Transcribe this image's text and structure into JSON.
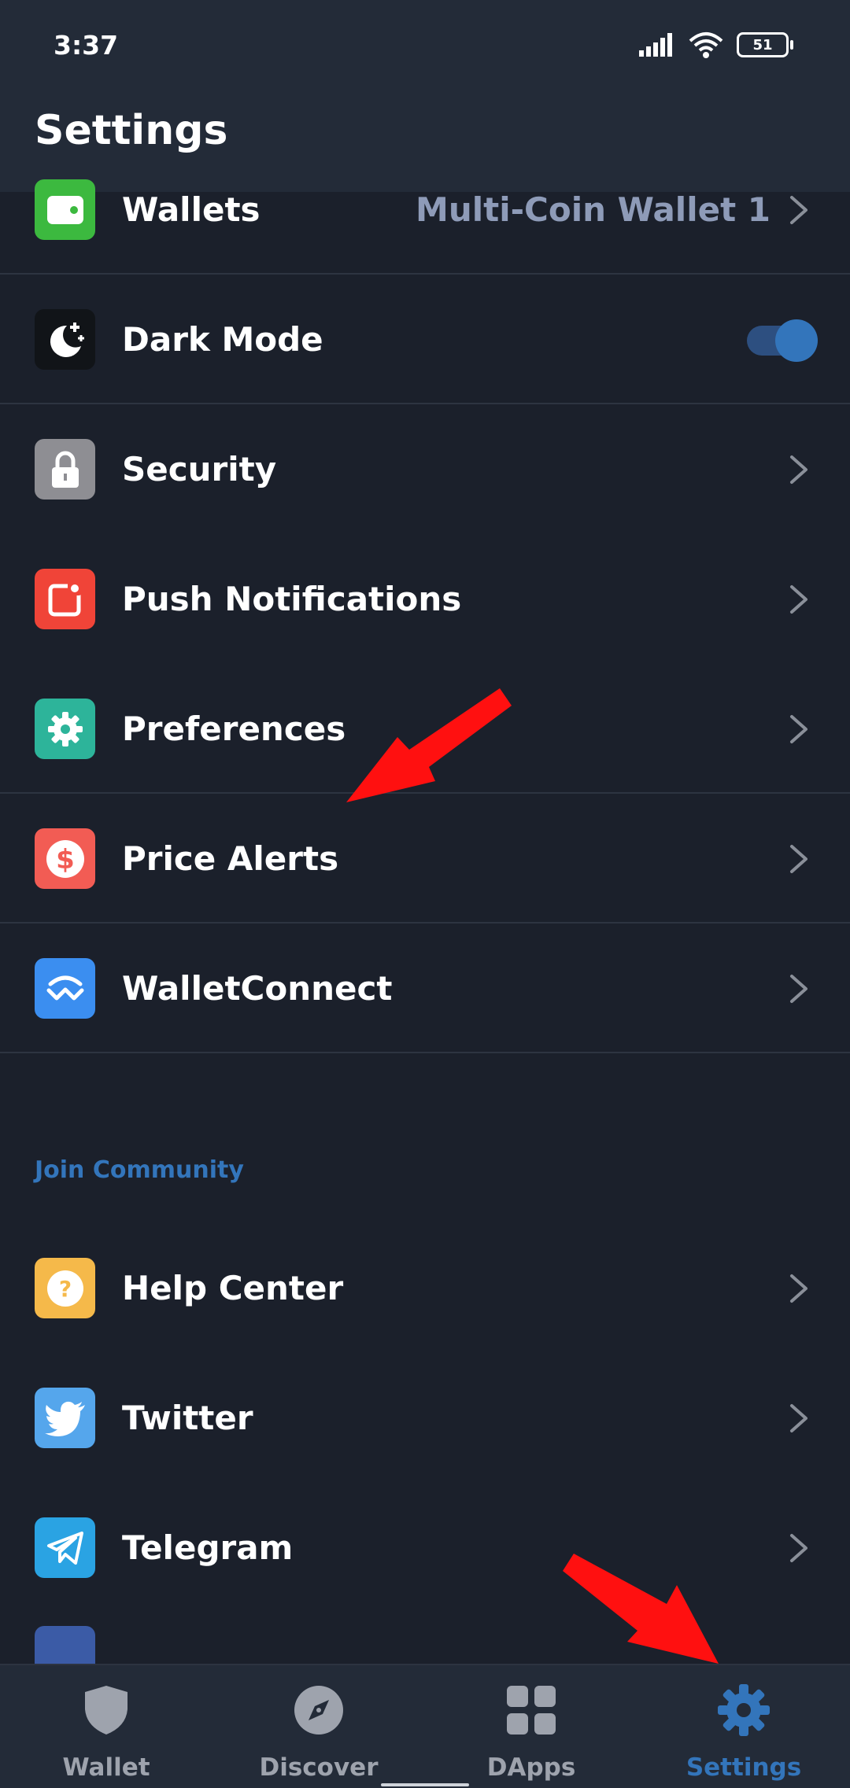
{
  "status_bar": {
    "time": "3:37",
    "battery": "51"
  },
  "header": {
    "title": "Settings"
  },
  "rows": [
    {
      "label": "Wallets",
      "value": "Multi-Coin Wallet 1",
      "icon": "wallet-icon",
      "icon_color": "#3cb93f"
    },
    {
      "label": "Dark Mode",
      "icon": "moon-icon",
      "icon_color": "#111418",
      "toggle_on": true
    },
    {
      "label": "Security",
      "icon": "lock-icon",
      "icon_color": "#8e8e93"
    },
    {
      "label": "Push Notifications",
      "icon": "notification-icon",
      "icon_color": "#f04438"
    },
    {
      "label": "Preferences",
      "icon": "gear-icon",
      "icon_color": "#2db49a"
    },
    {
      "label": "Price Alerts",
      "icon": "dollar-icon",
      "icon_color": "#f25c54"
    },
    {
      "label": "WalletConnect",
      "icon": "walletconnect-icon",
      "icon_color": "#3b8ef0"
    }
  ],
  "community": {
    "heading": "Join Community",
    "items": [
      {
        "label": "Help Center",
        "icon": "help-icon",
        "icon_color": "#f5b94a"
      },
      {
        "label": "Twitter",
        "icon": "twitter-icon",
        "icon_color": "#55a6ec"
      },
      {
        "label": "Telegram",
        "icon": "telegram-icon",
        "icon_color": "#2aa3e3"
      }
    ]
  },
  "tabbar": {
    "tabs": [
      {
        "label": "Wallet",
        "icon": "shield-icon"
      },
      {
        "label": "Discover",
        "icon": "compass-icon"
      },
      {
        "label": "DApps",
        "icon": "grid-icon"
      },
      {
        "label": "Settings",
        "icon": "gear-icon",
        "active": true
      }
    ]
  },
  "colors": {
    "accent": "#3375bb",
    "background": "#1b202b",
    "annotation_arrow": "#ff0000"
  }
}
